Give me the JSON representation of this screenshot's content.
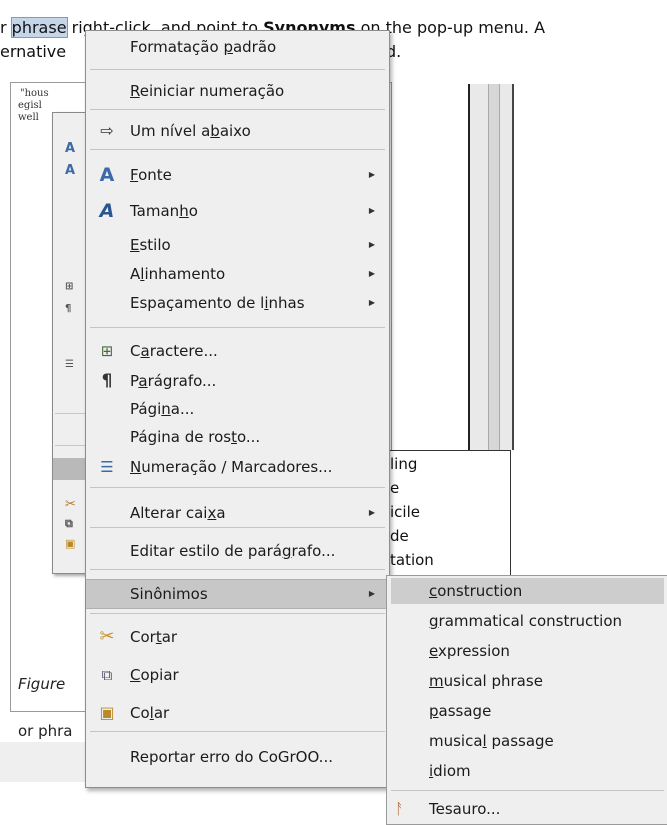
{
  "document": {
    "line1_pre": "r ",
    "line1_selected": "phrase",
    "line1_mid": " right-click, and point to ",
    "line1_bold": "Synonyms",
    "line1_post": " on the pop-up menu. A",
    "line2_pre": "ernative",
    "line2_post": "d.",
    "snippet_lines": [
      "\"hous",
      "egisl",
      "well"
    ],
    "list_words": [
      "ling",
      "e",
      "icile",
      "de",
      "tation"
    ],
    "caption": "Figure",
    "bottom_text": "or phra"
  },
  "context_menu": {
    "items": [
      {
        "id": "default_format",
        "pre": "Formatação ",
        "ul": "p",
        "post": "adrão",
        "icon": "",
        "submenu": false
      },
      {
        "id": "restart_numbering",
        "pre": "",
        "ul": "R",
        "post": "einiciar numeração",
        "icon": "",
        "submenu": false
      },
      {
        "id": "one_level_down",
        "pre": "Um nível a",
        "ul": "b",
        "post": "aixo",
        "icon": "arrow-right-icon",
        "submenu": false
      },
      {
        "id": "font",
        "pre": "",
        "ul": "F",
        "post": "onte",
        "icon": "font-icon",
        "submenu": true
      },
      {
        "id": "size",
        "pre": "Taman",
        "ul": "h",
        "post": "o",
        "icon": "font-size-icon",
        "submenu": true
      },
      {
        "id": "style",
        "pre": "",
        "ul": "E",
        "post": "stilo",
        "icon": "",
        "submenu": true
      },
      {
        "id": "alignment",
        "pre": "A",
        "ul": "l",
        "post": "inhamento",
        "icon": "",
        "submenu": true
      },
      {
        "id": "line_spacing",
        "pre": "Espaçamento de l",
        "ul": "i",
        "post": "nhas",
        "icon": "",
        "submenu": true
      },
      {
        "id": "character",
        "pre": "C",
        "ul": "a",
        "post": "ractere...",
        "icon": "character-icon",
        "submenu": false
      },
      {
        "id": "paragraph",
        "pre": "P",
        "ul": "a",
        "post": "rágrafo...",
        "icon": "paragraph-icon",
        "submenu": false
      },
      {
        "id": "page",
        "pre": "Pági",
        "ul": "n",
        "post": "a...",
        "icon": "",
        "submenu": false
      },
      {
        "id": "title_page",
        "pre": "Página de ros",
        "ul": "t",
        "post": "o...",
        "icon": "",
        "submenu": false
      },
      {
        "id": "numbering",
        "pre": "",
        "ul": "N",
        "post": "umeração / Marcadores...",
        "icon": "numbering-icon",
        "submenu": false
      },
      {
        "id": "change_case",
        "pre": "Alterar cai",
        "ul": "x",
        "post": "a",
        "icon": "",
        "submenu": true
      },
      {
        "id": "edit_para_style",
        "pre": "Editar estilo de pará",
        "ul": "g",
        "post": "rafo...",
        "icon": "",
        "submenu": false
      },
      {
        "id": "synonyms",
        "pre": "Sinônimos",
        "ul": "",
        "post": "",
        "icon": "",
        "submenu": true
      },
      {
        "id": "cut",
        "pre": "Cor",
        "ul": "t",
        "post": "ar",
        "icon": "scissors-icon",
        "submenu": false
      },
      {
        "id": "copy",
        "pre": "",
        "ul": "C",
        "post": "opiar",
        "icon": "copy-icon",
        "submenu": false
      },
      {
        "id": "paste",
        "pre": "Co",
        "ul": "l",
        "post": "ar",
        "icon": "paste-icon",
        "submenu": false
      },
      {
        "id": "report_error",
        "pre": "Reportar erro do CoGrOO...",
        "ul": "",
        "post": "",
        "icon": "",
        "submenu": false
      }
    ]
  },
  "synonyms_menu": {
    "items": [
      {
        "pre": "",
        "ul": "c",
        "post": "onstruction"
      },
      {
        "pre": "",
        "ul": "g",
        "post": "rammatical construction"
      },
      {
        "pre": "",
        "ul": "e",
        "post": "xpression"
      },
      {
        "pre": "",
        "ul": "m",
        "post": "usical phrase"
      },
      {
        "pre": "",
        "ul": "p",
        "post": "assage"
      },
      {
        "pre": "musica",
        "ul": "l",
        "post": " passage"
      },
      {
        "pre": "",
        "ul": "i",
        "post": "diom"
      }
    ],
    "thesaurus": {
      "pre": "Tesauro...",
      "ul": "",
      "post": "",
      "icon": "thesaurus-icon"
    }
  }
}
